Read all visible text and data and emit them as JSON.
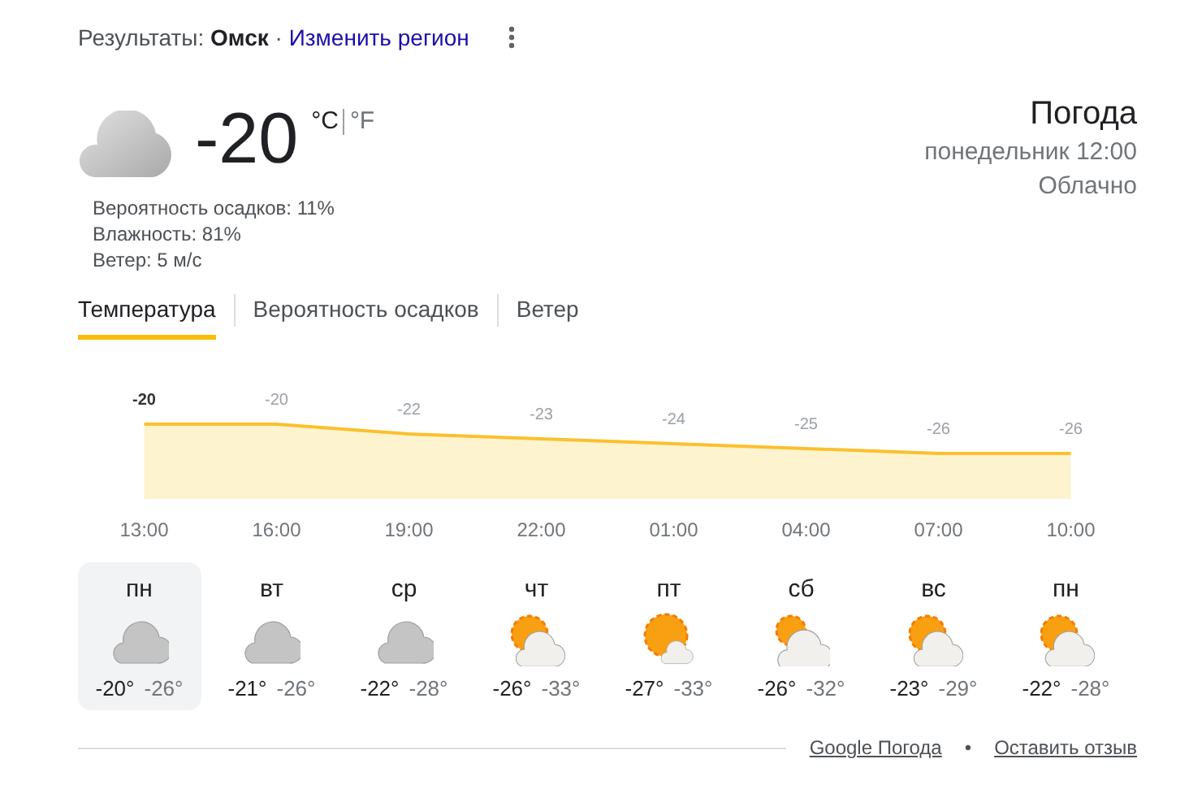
{
  "header": {
    "prefix": "Результаты: ",
    "city": "Омск",
    "separator": " · ",
    "change_region": "Изменить регион"
  },
  "current": {
    "kind": "cloudy",
    "temperature": "-20",
    "units": [
      {
        "label": "°C",
        "selected": true
      },
      {
        "label": "°F",
        "selected": false
      }
    ],
    "details": [
      "Вероятность осадков: 11%",
      "Влажность: 81%",
      "Ветер: 5 м/с"
    ],
    "title": "Погода",
    "time": "понедельник 12:00",
    "condition": "Облачно"
  },
  "tabs": [
    {
      "label": "Температура",
      "selected": true
    },
    {
      "label": "Вероятность осадков",
      "selected": false
    },
    {
      "label": "Ветер",
      "selected": false
    }
  ],
  "chart_data": {
    "type": "area",
    "categories": [
      "13:00",
      "16:00",
      "19:00",
      "22:00",
      "01:00",
      "04:00",
      "07:00",
      "10:00"
    ],
    "values": [
      -20,
      -20,
      -22,
      -23,
      -24,
      -25,
      -26,
      -26
    ],
    "data_labels": true
  },
  "days": [
    {
      "day": "пн",
      "kind": "cloudy",
      "high": "-20°",
      "low": "-26°",
      "selected": true
    },
    {
      "day": "вт",
      "kind": "cloudy",
      "high": "-21°",
      "low": "-26°",
      "selected": false
    },
    {
      "day": "ср",
      "kind": "cloudy",
      "high": "-22°",
      "low": "-28°",
      "selected": false
    },
    {
      "day": "чт",
      "kind": "partly_cloudy",
      "high": "-26°",
      "low": "-33°",
      "selected": false
    },
    {
      "day": "пт",
      "kind": "mostly_sunny",
      "high": "-27°",
      "low": "-33°",
      "selected": false
    },
    {
      "day": "сб",
      "kind": "mostly_cloudy",
      "high": "-26°",
      "low": "-32°",
      "selected": false
    },
    {
      "day": "вс",
      "kind": "partly_cloudy",
      "high": "-23°",
      "low": "-29°",
      "selected": false
    },
    {
      "day": "пн",
      "kind": "partly_cloudy",
      "high": "-22°",
      "low": "-28°",
      "selected": false
    }
  ],
  "footer": {
    "links": [
      "Google Погода",
      "Оставить отзыв"
    ],
    "separator": "•"
  }
}
